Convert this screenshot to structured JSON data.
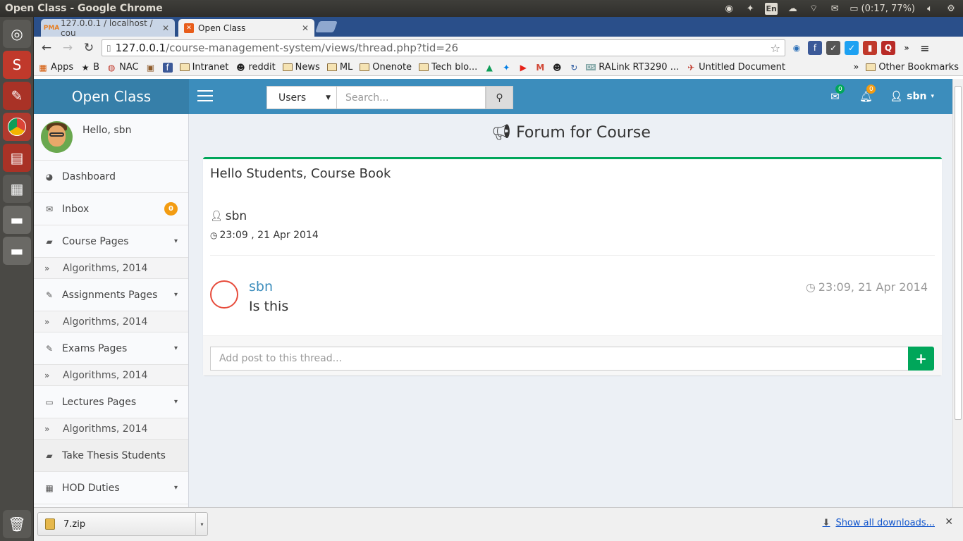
{
  "os": {
    "window_title": "Open Class - Google Chrome",
    "lang": "En",
    "battery": "(0:17, 77%)"
  },
  "browser": {
    "tabs": [
      {
        "label": "127.0.0.1 / localhost / cou",
        "icon": "phpmyadmin-icon"
      },
      {
        "label": "Open Class",
        "icon": "xampp-icon"
      }
    ],
    "url_host": "127.0.0.1",
    "url_path": "/course-management-system/views/thread.php?tid=26",
    "bookmarks": [
      "Apps",
      "B",
      "NAC",
      "Intranet",
      "reddit",
      "News",
      "ML",
      "Onenote",
      "Tech blo...",
      "RALink RT3290 ...",
      "Untitled Document"
    ],
    "bookmarks_more": "»",
    "other_bookmarks": "Other Bookmarks"
  },
  "app": {
    "logo": "Open Class",
    "search_select": "Users",
    "search_placeholder": "Search...",
    "mail_count": "0",
    "notif_count": "0",
    "user_name": "sbn",
    "hello": "Hello, sbn",
    "colors": {
      "header": "#3c8dbc",
      "accent_green": "#00a65a",
      "badge_orange": "#f39c12"
    }
  },
  "sidebar": {
    "dashboard": "Dashboard",
    "inbox": "Inbox",
    "inbox_badge": "0",
    "course_pages": "Course Pages",
    "course_sub": "Algorithms, 2014",
    "assignments_pages": "Assignments Pages",
    "assignments_sub": "Algorithms, 2014",
    "exams_pages": "Exams Pages",
    "exams_sub": "Algorithms, 2014",
    "lectures_pages": "Lectures Pages",
    "lectures_sub": "Algorithms, 2014",
    "thesis": "Take Thesis Students",
    "hod": "HOD Duties"
  },
  "thread": {
    "page_title": "Forum for Course",
    "title": "Hello Students, Course Book",
    "author": "sbn",
    "date": "23:09 , 21 Apr 2014",
    "post": {
      "name": "sbn",
      "text": "Is this",
      "time": "23:09, 21 Apr 2014"
    },
    "reply_placeholder": "Add post to this thread...",
    "reply_button": "+"
  },
  "downloads": {
    "file": "7.zip",
    "show_all": "Show all downloads..."
  }
}
